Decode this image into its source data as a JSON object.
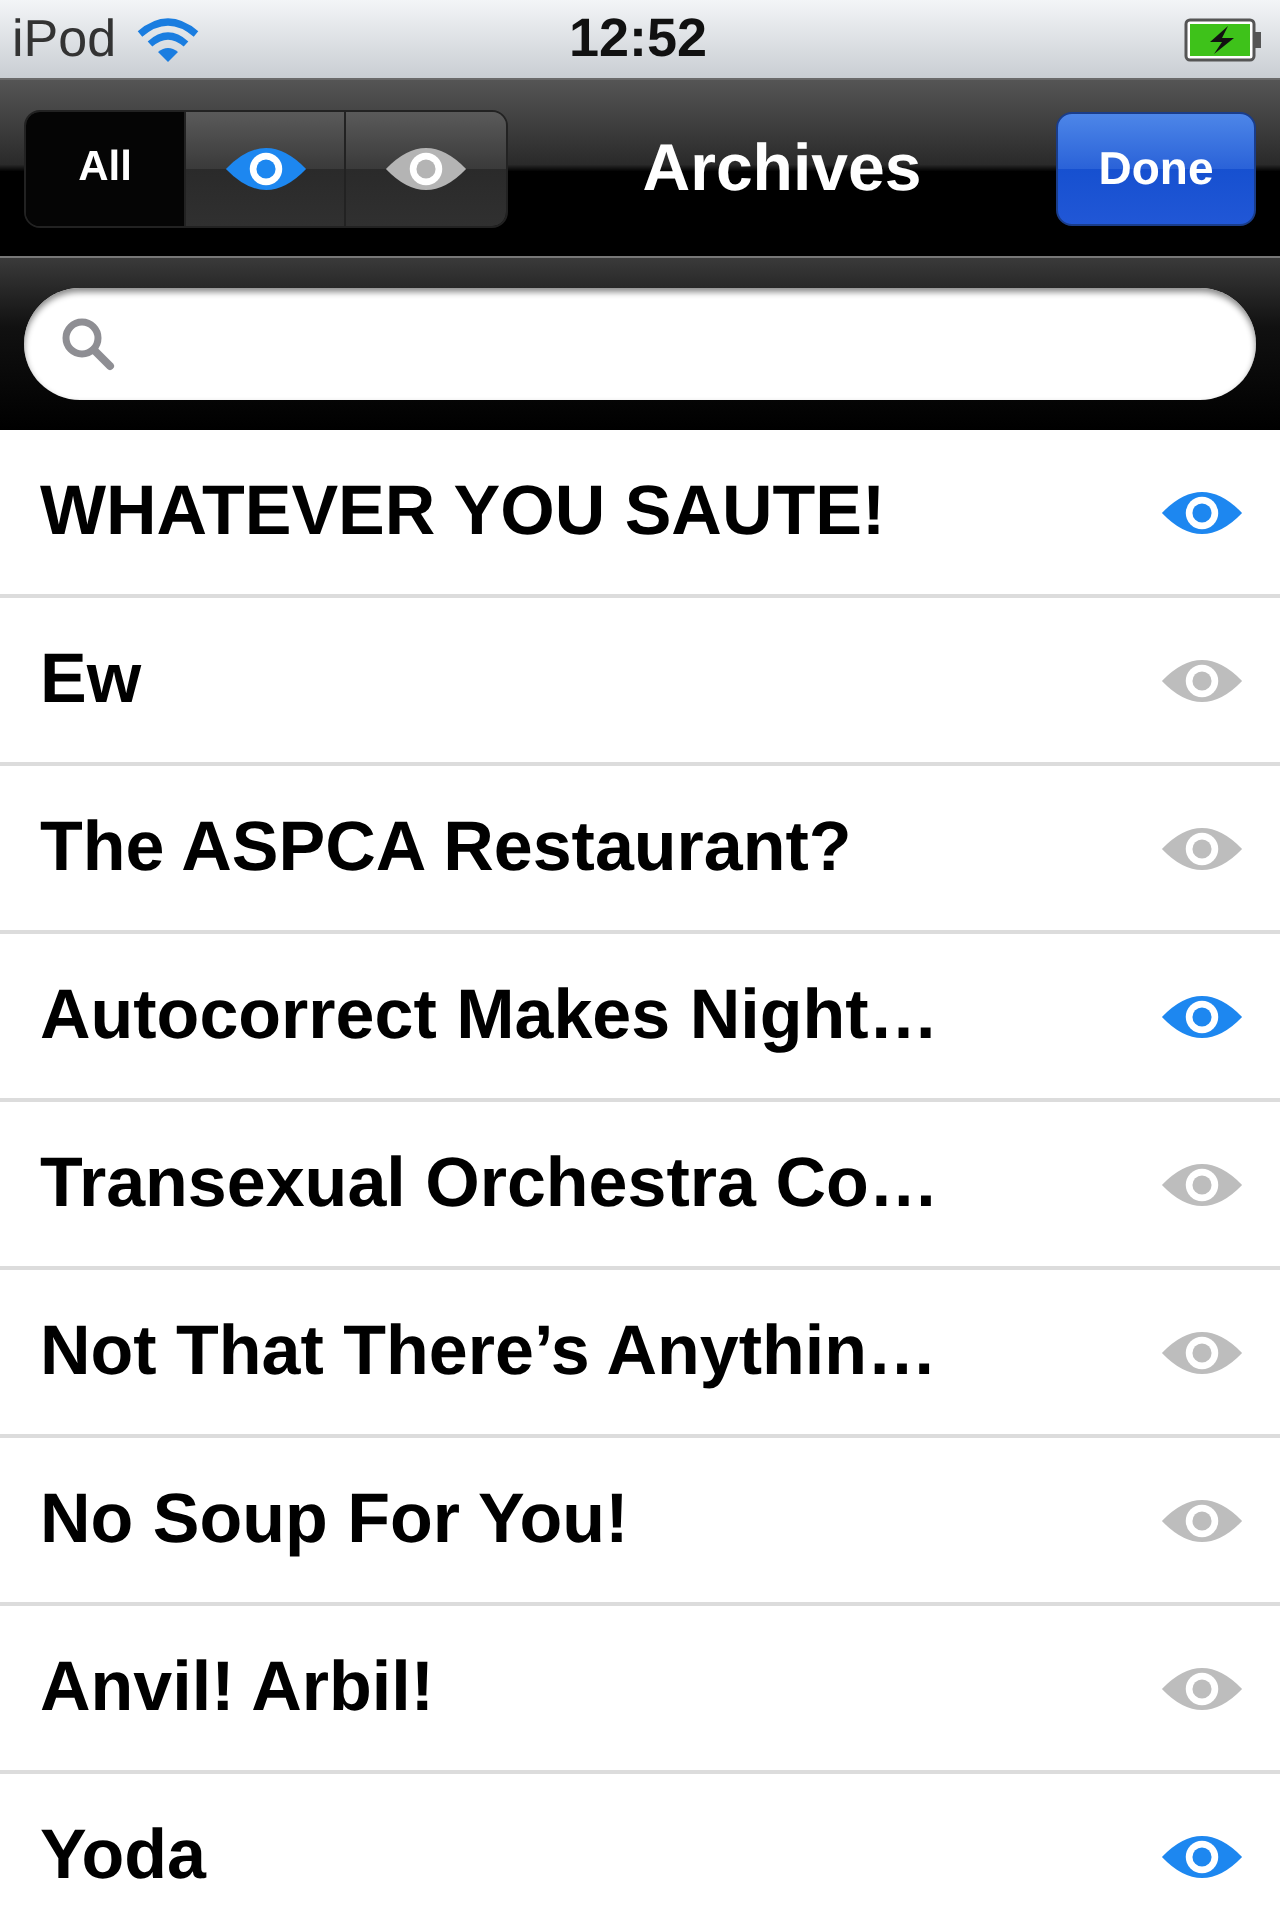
{
  "status_bar": {
    "carrier": "iPod",
    "time": "12:52"
  },
  "nav_bar": {
    "title": "Archives",
    "done_button": "Done",
    "segments": [
      {
        "kind": "label",
        "label": "All",
        "selected": true
      },
      {
        "kind": "watched",
        "selected": false
      },
      {
        "kind": "unwatched",
        "selected": false
      }
    ]
  },
  "rows": [
    {
      "title": "WHATEVER YOU SAUTE!",
      "watched": true
    },
    {
      "title": "Ew",
      "watched": false
    },
    {
      "title": "The ASPCA Restaurant?",
      "watched": false
    },
    {
      "title": "Autocorrect Makes Night…",
      "watched": true
    },
    {
      "title": "Transexual Orchestra Co…",
      "watched": false
    },
    {
      "title": "Not That There’s Anythin…",
      "watched": false
    },
    {
      "title": "No Soup For You!",
      "watched": false
    },
    {
      "title": "Anvil! Arbil!",
      "watched": false
    },
    {
      "title": "Yoda",
      "watched": true
    }
  ]
}
